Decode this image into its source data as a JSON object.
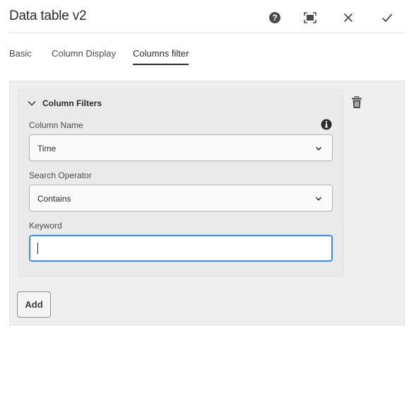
{
  "dialog": {
    "title": "Data table v2",
    "icons": {
      "help": "help-icon",
      "fullscreen": "fullscreen-icon",
      "close": "close-icon",
      "done": "checkmark-icon"
    }
  },
  "tabs": [
    {
      "label": "Basic",
      "active": false
    },
    {
      "label": "Column Display",
      "active": false
    },
    {
      "label": "Columns filter",
      "active": true
    }
  ],
  "filter_card": {
    "title": "Column Filters",
    "expanded": true,
    "column_name": {
      "label": "Column Name",
      "value": "Time"
    },
    "search_operator": {
      "label": "Search Operator",
      "value": "Contains"
    },
    "keyword": {
      "label": "Keyword",
      "value": "",
      "placeholder": ""
    }
  },
  "actions": {
    "add_label": "Add"
  },
  "colors": {
    "focus": "#378ef0",
    "panel_bg": "#efefef",
    "text": "#2c2c2c"
  }
}
